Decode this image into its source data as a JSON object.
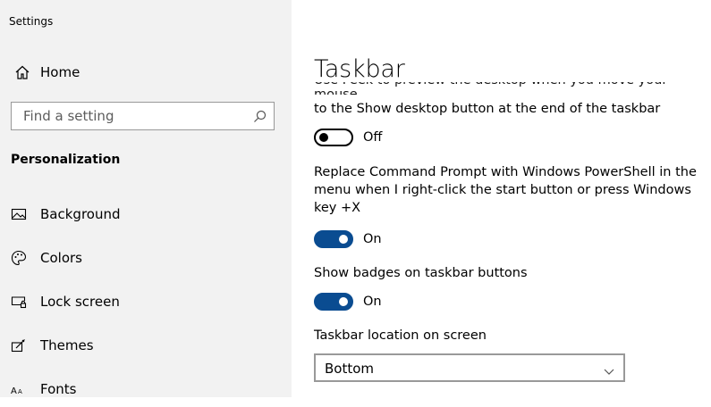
{
  "window": {
    "title": "Settings"
  },
  "sidebar": {
    "home_label": "Home",
    "search_placeholder": "Find a setting",
    "section_label": "Personalization",
    "items": [
      {
        "label": "Background",
        "icon": "picture-icon"
      },
      {
        "label": "Colors",
        "icon": "palette-icon"
      },
      {
        "label": "Lock screen",
        "icon": "lock-screen-icon"
      },
      {
        "label": "Themes",
        "icon": "themes-icon"
      },
      {
        "label": "Fonts",
        "icon": "font-icon"
      }
    ]
  },
  "main": {
    "title": "Taskbar",
    "partial_text": "Use Peek to preview the desktop when you move your mouse",
    "settings": [
      {
        "description": "to the Show desktop button at the end of the taskbar",
        "state": "Off",
        "enabled": false
      },
      {
        "description": "Replace Command Prompt with Windows PowerShell in the menu when I right-click the start button or press Windows key +X",
        "state": "On",
        "enabled": true
      },
      {
        "description": "Show badges on taskbar buttons",
        "state": "On",
        "enabled": true
      }
    ],
    "location": {
      "label": "Taskbar location on screen",
      "value": "Bottom"
    }
  },
  "colors": {
    "accent": "#0a4c91",
    "sidebar_bg": "#f2f2f2"
  }
}
